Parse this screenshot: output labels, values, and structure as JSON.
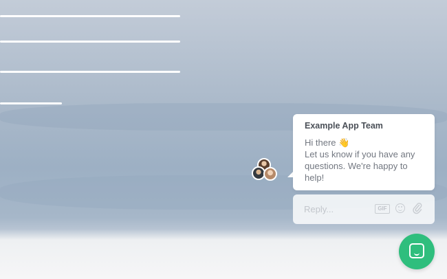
{
  "chat": {
    "team_name": "Example App Team",
    "greeting": "Hi there 👋",
    "message_lines": [
      "Let us know if you have any",
      "questions. We're happy to",
      "help!"
    ]
  },
  "reply": {
    "placeholder": "Reply...",
    "gif_label": "GIF"
  },
  "colors": {
    "launcher": "#2fbe7d",
    "background": "#a9b8c9"
  },
  "icons": [
    "gif-icon",
    "emoji-icon",
    "attachment-icon",
    "chat-launcher-icon"
  ]
}
